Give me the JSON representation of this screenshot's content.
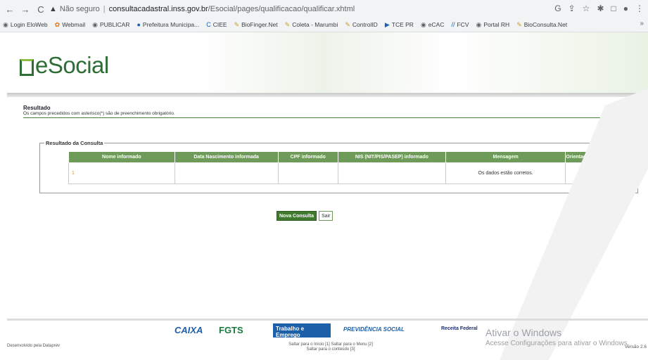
{
  "browser": {
    "security": "Não seguro",
    "url_host": "consultacadastral.inss.gov.br",
    "url_path": "/Esocial/pages/qualificacao/qualificar.xhtml",
    "bookmarks": [
      "Login EloWeb",
      "Webmail",
      "PUBLICAR",
      "Prefeitura Municipa...",
      "CIEE",
      "BioFinger.Net",
      "Coleta - Marumbi",
      "ControlID",
      "TCE PR",
      "eCAC",
      "FCV",
      "Portal RH",
      "BioConsulta.Net"
    ],
    "more": "»"
  },
  "header": {
    "logo_text": "eSocial"
  },
  "result": {
    "title": "Resultado",
    "subtitle": "Os campos precedidos com asterisco(*) são de preenchimento obrigatório.",
    "legend": "Resultado da Consulta",
    "columns": [
      "Nome informado",
      "Data Nascimento informada",
      "CPF informado",
      "NIS (NIT/PIS/PASEP) informado",
      "Mensagem",
      "Orientação"
    ],
    "rows": [
      {
        "index": "1",
        "nome": "",
        "data": "",
        "cpf": "",
        "nis": "",
        "mensagem": "Os dados estão corretos.",
        "orientacao": ""
      }
    ]
  },
  "actions": {
    "new_query": "Nova Consulta",
    "exit": "Sair"
  },
  "footer": {
    "brands": [
      "CAIXA",
      "FGTS",
      "Trabalho e Emprego",
      "PREVIDÊNCIA SOCIAL",
      "Receita Federal"
    ],
    "dev": "Desenvolvido pela Dataprev",
    "skip1": "Saltar para o Início [1]",
    "skip2": "Saltar para o Menu [2]",
    "skip3": "Saltar para o conteúdo [3]",
    "version": "Versão 2.6"
  },
  "overlay": {
    "line1": "Ativar o Windows",
    "line2": "Acesse Configurações para ativar o Windows."
  },
  "colors": {
    "accent": "#3f7a2e",
    "header_th": "#6e9a5a"
  }
}
